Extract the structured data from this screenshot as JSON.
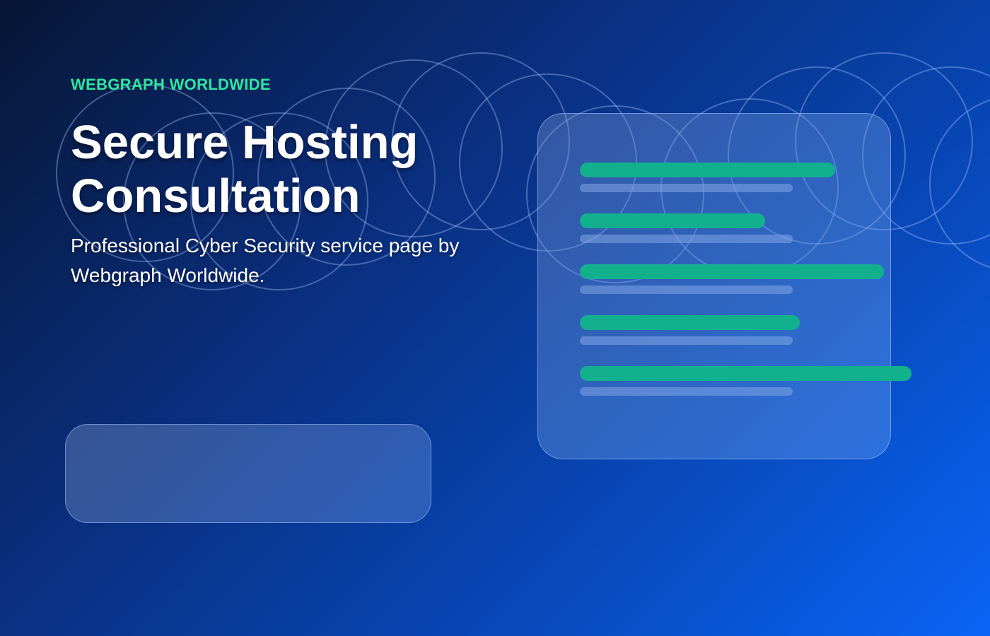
{
  "brand": {
    "name": "WEBGRAPH WORLDWIDE",
    "color": "#2ee6a0"
  },
  "hero": {
    "title": "Secure Hosting Consultation",
    "subtitle": "Professional Cyber Security service page by Webgraph Worldwide."
  },
  "colors": {
    "accent_green": "#13b08e",
    "bar_muted": "#7fa3e0",
    "ring_stroke": "#a9c2ff"
  },
  "card": {
    "rows": [
      {
        "fill_fraction": 0.73
      },
      {
        "fill_fraction": 0.53
      },
      {
        "fill_fraction": 0.87
      },
      {
        "fill_fraction": 0.63
      },
      {
        "fill_fraction": 0.95
      }
    ]
  }
}
